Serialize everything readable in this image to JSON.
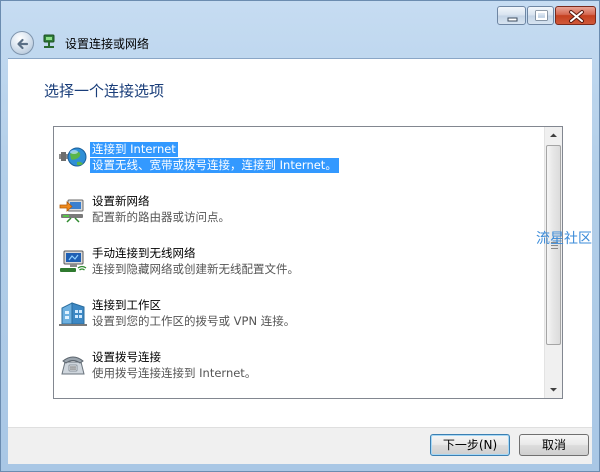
{
  "window": {
    "controls": [
      "minimize",
      "maximize",
      "close"
    ]
  },
  "nav": {
    "title": "设置连接或网络",
    "back_icon": "back-arrow-icon",
    "app_icon": "network-connection-icon"
  },
  "heading": "选择一个连接选项",
  "options": [
    {
      "title": "连接到 Internet",
      "desc": "设置无线、宽带或拨号连接，连接到 Internet。",
      "icon": "globe-internet-icon",
      "selected": true
    },
    {
      "title": "设置新网络",
      "desc": "配置新的路由器或访问点。",
      "icon": "new-network-icon",
      "selected": false
    },
    {
      "title": "手动连接到无线网络",
      "desc": "连接到隐藏网络或创建新无线配置文件。",
      "icon": "wireless-network-icon",
      "selected": false
    },
    {
      "title": "连接到工作区",
      "desc": "设置到您的工作区的拨号或 VPN 连接。",
      "icon": "workplace-icon",
      "selected": false
    },
    {
      "title": "设置拨号连接",
      "desc": "使用拨号连接连接到 Internet。",
      "icon": "dialup-phone-icon",
      "selected": false
    }
  ],
  "watermark": "流星社区",
  "buttons": {
    "next": "下一步(N)",
    "cancel": "取消"
  },
  "colors": {
    "selection": "#3399ff",
    "heading": "#1a3e7a",
    "frame": "#b3cfe9"
  }
}
